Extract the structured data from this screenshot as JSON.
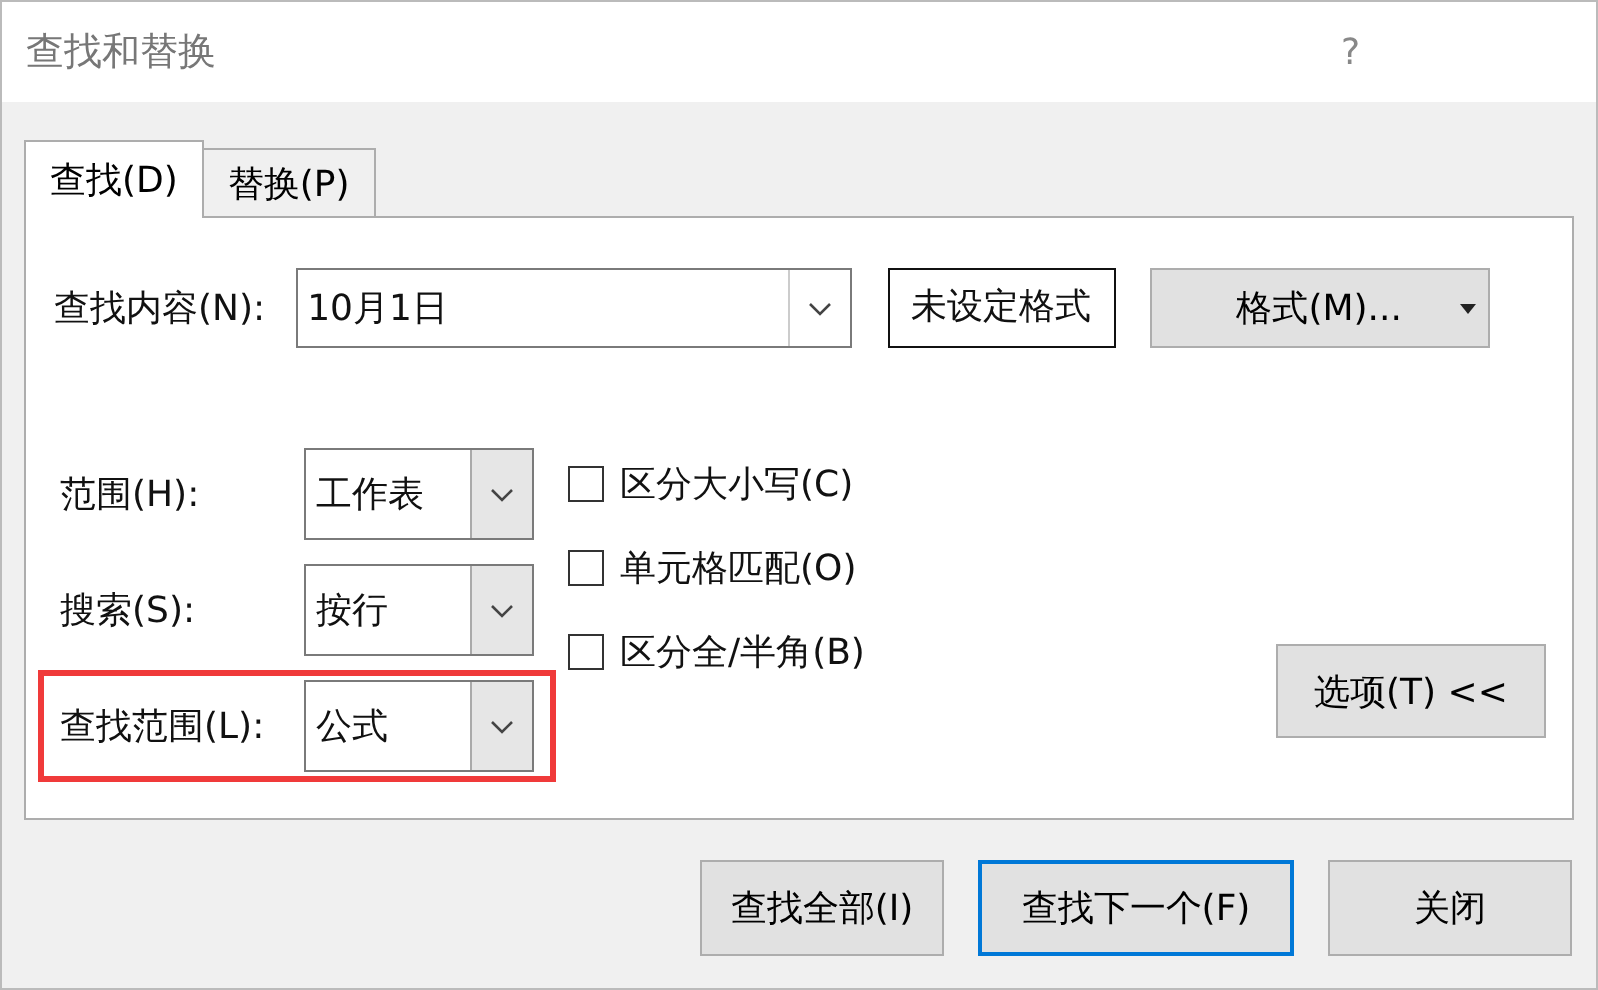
{
  "window": {
    "title": "查找和替换",
    "help": "?"
  },
  "tabs": [
    {
      "label": "查找(D)",
      "selected": true
    },
    {
      "label": "替换(P)",
      "selected": false
    }
  ],
  "find": {
    "label": "查找内容(N):",
    "value": "10月1日",
    "format_preview": "未设定格式",
    "format_button": "格式(M)..."
  },
  "options": [
    {
      "label": "范围(H):",
      "value": "工作表",
      "highlighted": false
    },
    {
      "label": "搜索(S):",
      "value": "按行",
      "highlighted": false
    },
    {
      "label": "查找范围(L):",
      "value": "公式",
      "highlighted": true
    }
  ],
  "checkboxes": [
    {
      "label": "区分大小写(C)",
      "checked": false
    },
    {
      "label": "单元格匹配(O)",
      "checked": false
    },
    {
      "label": "区分全/半角(B)",
      "checked": false
    }
  ],
  "options_button": "选项(T) <<",
  "buttons": [
    {
      "label": "查找全部(I)",
      "default": false
    },
    {
      "label": "查找下一个(F)",
      "default": true
    },
    {
      "label": "关闭",
      "default": false
    }
  ]
}
